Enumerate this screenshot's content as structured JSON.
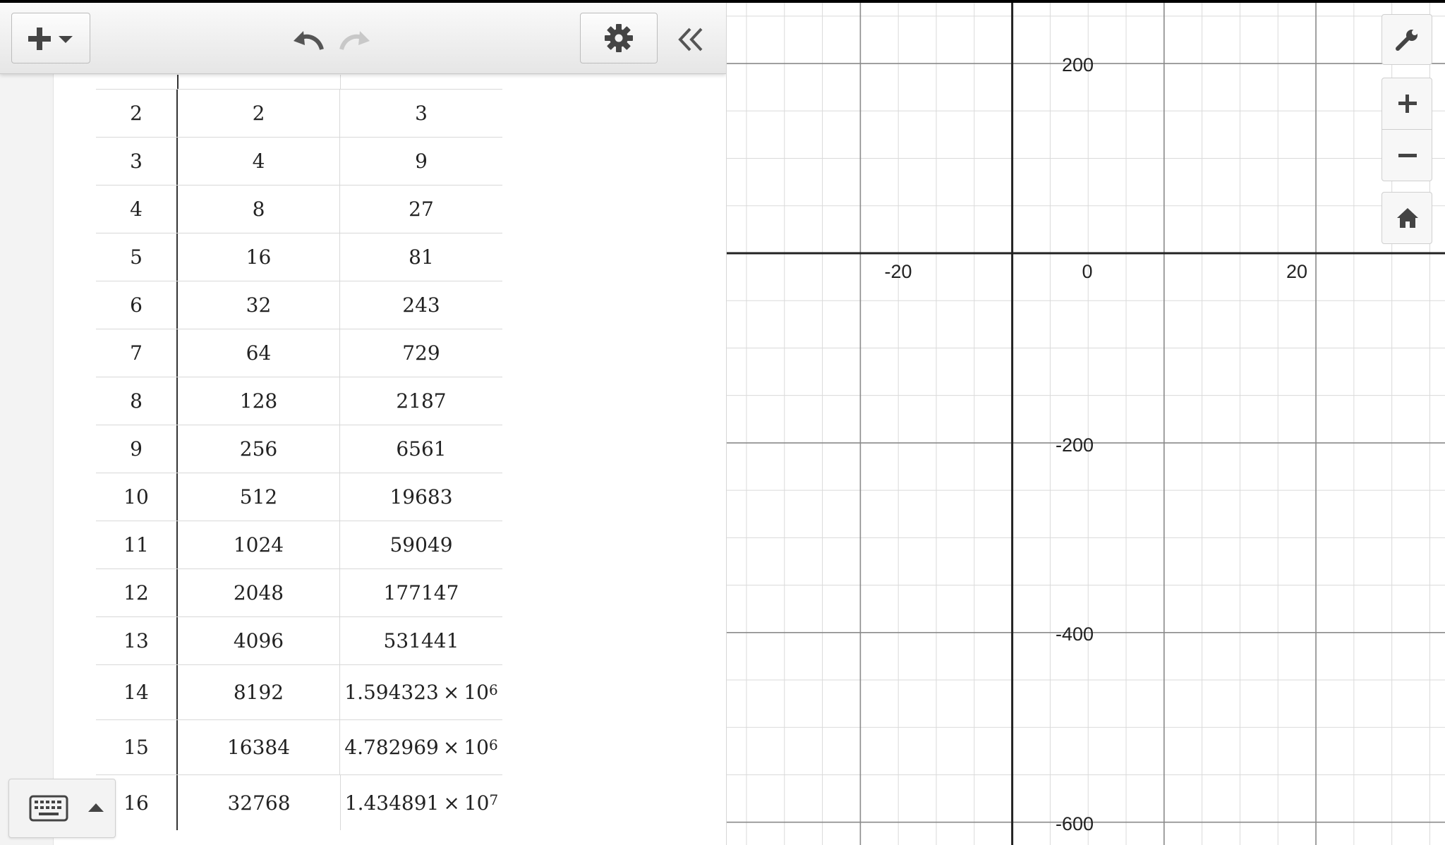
{
  "toolbar": {
    "add_icon": "plus-icon",
    "undo_icon": "undo-icon",
    "redo_icon": "redo-icon",
    "settings_icon": "gear-icon",
    "collapse_icon": "double-chevron-left-icon"
  },
  "table": {
    "rows": [
      {
        "c1": "2",
        "c2": "2",
        "c3": "3"
      },
      {
        "c1": "3",
        "c2": "4",
        "c3": "9"
      },
      {
        "c1": "4",
        "c2": "8",
        "c3": "27"
      },
      {
        "c1": "5",
        "c2": "16",
        "c3": "81"
      },
      {
        "c1": "6",
        "c2": "32",
        "c3": "243"
      },
      {
        "c1": "7",
        "c2": "64",
        "c3": "729"
      },
      {
        "c1": "8",
        "c2": "128",
        "c3": "2187"
      },
      {
        "c1": "9",
        "c2": "256",
        "c3": "6561"
      },
      {
        "c1": "10",
        "c2": "512",
        "c3": "19683"
      },
      {
        "c1": "11",
        "c2": "1024",
        "c3": "59049"
      },
      {
        "c1": "12",
        "c2": "2048",
        "c3": "177147"
      },
      {
        "c1": "13",
        "c2": "4096",
        "c3": "531441"
      },
      {
        "c1": "14",
        "c2": "8192",
        "c3_mantissa": "1.594323",
        "c3_base": "10",
        "c3_exp": "6"
      },
      {
        "c1": "15",
        "c2": "16384",
        "c3_mantissa": "4.782969",
        "c3_base": "10",
        "c3_exp": "6"
      },
      {
        "c1": "16",
        "c2": "32768",
        "c3_mantissa": "1.434891",
        "c3_base": "10",
        "c3_exp": "7"
      }
    ]
  },
  "keyboard": {
    "icon": "keyboard-icon",
    "toggle_icon": "caret-up-icon"
  },
  "graph": {
    "x_ticks": [
      "-20",
      "20"
    ],
    "y_ticks": [
      "200",
      "-200",
      "-400",
      "-600"
    ],
    "origin_label": "0",
    "x_range": [
      -37.6,
      57.0
    ],
    "y_range": [
      -624,
      264
    ],
    "controls": [
      "wrench-icon",
      "zoom-in-icon",
      "zoom-out-icon",
      "home-icon"
    ]
  }
}
